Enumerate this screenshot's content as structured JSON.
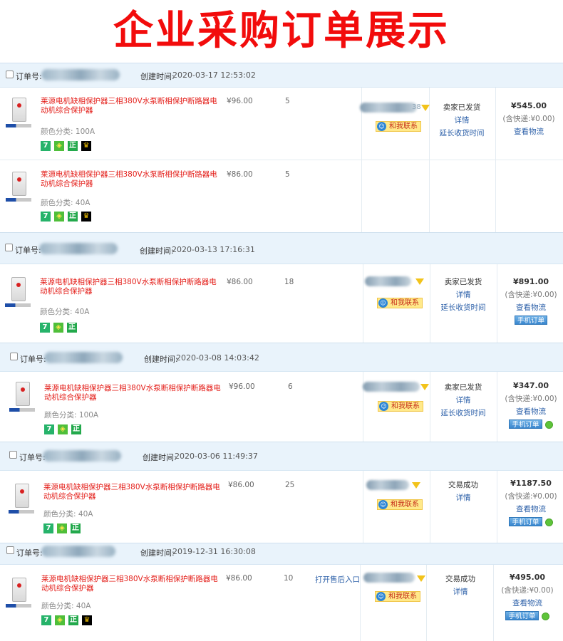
{
  "banner": {
    "title": "企业采购订单展示"
  },
  "labels": {
    "order_no": "订单号:",
    "created": "创建时间:",
    "contact": "和我联系",
    "detail": "详情",
    "extend": "延长收货时间",
    "logistics": "查看物流",
    "mobile_order": "手机订单",
    "aftersale": "打开售后入口",
    "color_label": "颜色分类:"
  },
  "product_title": "莱源电机缺相保护器三相380V水泵断相保护断路器电动机综合保护器",
  "orders": [
    {
      "created_time": "2020-03-17 12:53:02",
      "seller_suffix": "38",
      "status": "卖家已发货",
      "total": "¥545.00",
      "shipping": "(含快递:¥0.00)",
      "items": [
        {
          "price": "¥96.00",
          "qty": "5",
          "color": "100A",
          "badges": [
            "7",
            "shield",
            "正",
            "crown"
          ]
        },
        {
          "price": "¥86.00",
          "qty": "5",
          "color": "40A",
          "badges": [
            "7",
            "shield",
            "正",
            "crown"
          ]
        }
      ]
    },
    {
      "created_time": "2020-03-13 17:16:31",
      "status": "卖家已发货",
      "total": "¥891.00",
      "shipping": "(含快递:¥0.00)",
      "items": [
        {
          "price": "¥86.00",
          "qty": "18",
          "color": "40A",
          "badges": [
            "7",
            "shield",
            "正"
          ]
        }
      ]
    },
    {
      "created_time": "2020-03-08 14:03:42",
      "status": "卖家已发货",
      "total": "¥347.00",
      "shipping": "(含快递:¥0.00)",
      "items": [
        {
          "price": "¥96.00",
          "qty": "6",
          "color": "100A",
          "badges": [
            "7",
            "shield",
            "正"
          ]
        }
      ]
    },
    {
      "created_time": "2020-03-06 11:49:37",
      "status": "交易成功",
      "total": "¥1187.50",
      "shipping": "(含快递:¥0.00)",
      "items": [
        {
          "price": "¥86.00",
          "qty": "25",
          "color": "40A",
          "badges": [
            "7",
            "shield",
            "正"
          ]
        }
      ]
    },
    {
      "created_time": "2019-12-31 16:30:08",
      "status": "交易成功",
      "total": "¥495.00",
      "shipping": "(含快递:¥0.00)",
      "items": [
        {
          "price": "¥86.00",
          "qty": "10",
          "color": "40A",
          "badges": [
            "7",
            "shield",
            "正",
            "crown"
          ]
        }
      ]
    }
  ],
  "badge_glyphs": {
    "7": "7",
    "shield": "◈",
    "正": "正",
    "crown": "♛"
  },
  "colors": {
    "banner_red": "#f20c0c",
    "header_bg": "#e9f3fb",
    "link_blue": "#2b5fa8",
    "title_red": "#e4201b"
  }
}
